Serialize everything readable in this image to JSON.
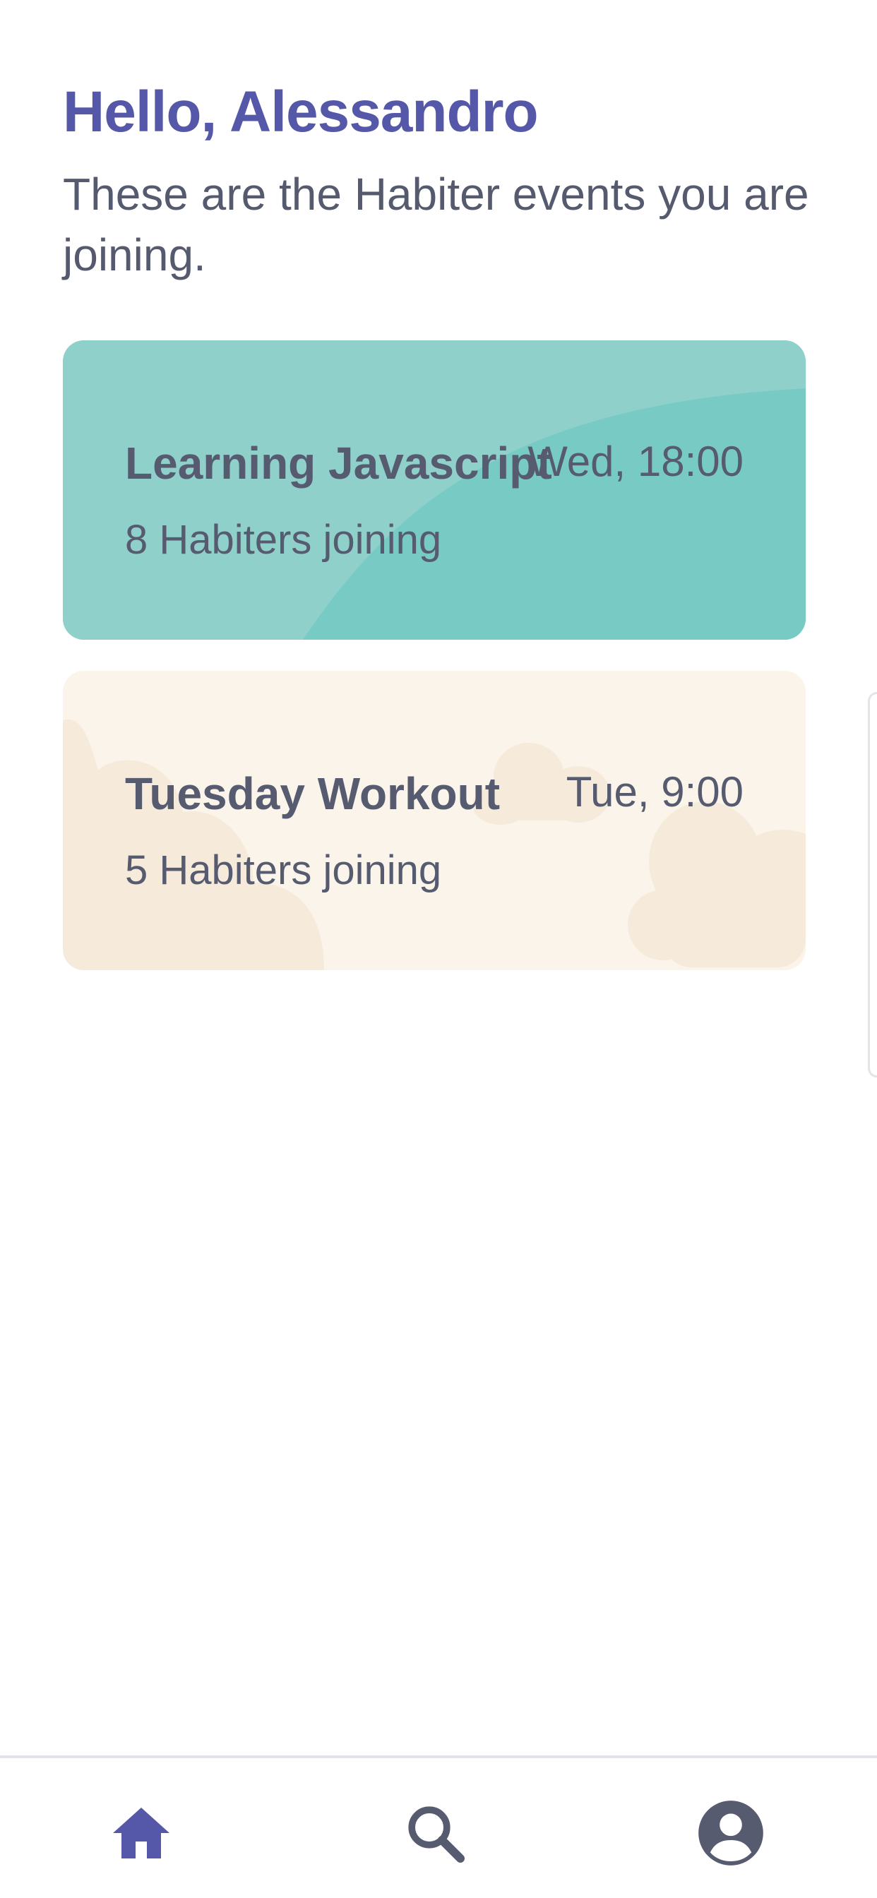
{
  "header": {
    "greeting": "Hello, Alessandro",
    "subtitle": "These are the Habiter events you are joining."
  },
  "events": [
    {
      "title": "Learning Javascript",
      "time": "Wed, 18:00",
      "joining": "8 Habiters joining",
      "color": "#8fd0cb"
    },
    {
      "title": "Tuesday Workout",
      "time": "Tue, 9:00",
      "joining": "5 Habiters joining",
      "color": "#fbf4ea"
    }
  ],
  "tabbar": {
    "items": [
      {
        "icon": "home-icon",
        "active": true
      },
      {
        "icon": "search-icon",
        "active": false
      },
      {
        "icon": "account-icon",
        "active": false
      }
    ],
    "active_color": "#5558a9",
    "inactive_color": "#565b70"
  }
}
